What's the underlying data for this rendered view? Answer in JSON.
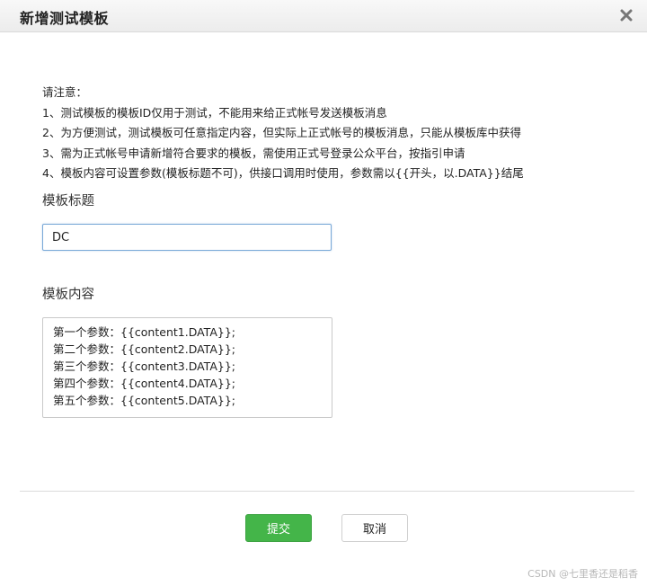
{
  "dialog": {
    "title": "新增测试模板",
    "close_icon": "close-icon"
  },
  "notice": {
    "heading": "请注意：",
    "items": [
      "1、测试模板的模板ID仅用于测试，不能用来给正式帐号发送模板消息",
      "2、为方便测试，测试模板可任意指定内容，但实际上正式帐号的模板消息，只能从模板库中获得",
      "3、需为正式帐号申请新增符合要求的模板，需使用正式号登录公众平台，按指引申请",
      "4、模板内容可设置参数(模板标题不可)，供接口调用时使用，参数需以{{开头，以.DATA}}结尾"
    ]
  },
  "form": {
    "title_label": "模板标题",
    "title_value": "DC",
    "content_label": "模板内容",
    "content_lines": [
      "第一个参数：{{content1.DATA}};",
      "第二个参数：{{content2.DATA}};",
      "第三个参数：{{content3.DATA}};",
      "第四个参数：{{content4.DATA}};",
      "第五个参数：{{content5.DATA}};"
    ]
  },
  "buttons": {
    "submit_label": "提交",
    "cancel_label": "取消"
  },
  "watermark": "CSDN @七里香还是稻香",
  "colors": {
    "submit_green": "#44b549",
    "input_focus_border": "#7aa9d8",
    "header_bg": "#f1f1f1"
  }
}
